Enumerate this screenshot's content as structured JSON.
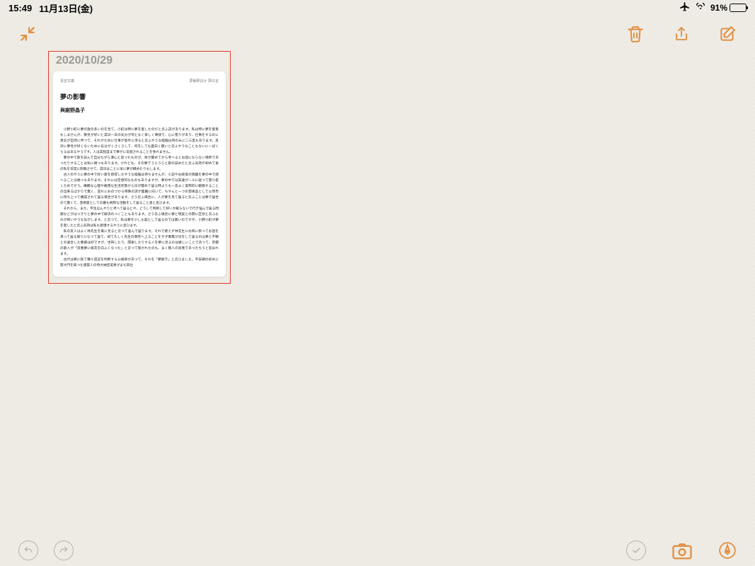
{
  "statusbar": {
    "time": "15:49",
    "date": "11月13日(金)",
    "battery_pct": "91%"
  },
  "note": {
    "date": "2020/10/29",
    "header_left": "青空文庫",
    "header_right": "夢解釈ほか 夢の言",
    "title": "夢の影響",
    "author": "與謝野晶子",
    "paragraphs": [
      "小野小町に夢の歌の多いのを見て、小町は特に夢を愛したのだと云ふ説があります。私は特に夢を愛意もしませんが、夢見が好いと其日一日の気分が何となく楽しく晴快で、心に張りがあり、仕事をするのに勇気が自然に伴つて、それがために仕事が意外に渉ると云ふやうな経験は持のみに二三度もあります。反対に夢見が好くないために気分がくさくさして、何をしても面白く無いと云ふやうなこともないにーぱくらるはあるやうです。人は其程度まで夢がに支配されることを免れません。",
      "夢の中で歌を読んで自分ながら満心と思つたものが、目が醒めてから考へるとお話にならない場所であつたりすることは私に幾つもあります。けれども、その夢でうらうらと歌の読めたと云ふ気持が却めて後の私を非常に刺戟させて、其日はことに早に夢が縁めたりもします。",
      "古人のやうに夢の中で好い歌を感得したやうな経験は持ちませんが、小説やお絵等の情趣を夢の中で感へることは幾つもあります。それには空想的なものもありますが、夢の中では其違がールに従つて張り抜くためでせう。睡眠な心理や複雑な生活状態から日が醒めて居る時よりもー思よく実際的に観察することの出来るばかりで無く、其れにおのづから特殊の詩が面麗に向いて、ちやんと一つの芸術品として公然市に持ち上つて構成されて居る場合があります。さう云ふ場合に、人が夢を見て居ると云ふことは夢で居合のて無くて、芸術家としての最も純粋な活動をして居ること意と思ひます。",
      "それから、また、平生ほんやりと考へて居るとや、どうして判断して好いか解らないで行き悩んで居る問題などがはつきりと夢の中で解決のつくこともあります。さう云ふ場合に夢と現実との間に区別と云ふものが新いやうな気がします。と云つて、私は夢を少しも超として居るのでは無いのですが、小野小町が夢を愛したと云ふ気持は私も意憤するやうに思ひます。",
      "私の友人はよく林先生を萬に見ると云つて喜んで居ります。それで絶えず林先生にお目に掛つてお話を承って居る様りになつて居て、却て久しく先生の御宅へ上ることをせず御無沙汰をして居るのは夢と不精との違合した悪癖は好ですが、世帯したり、間謝したりする人を夢に見るのは嬉しいことであつて、京都の歌人が「良寛夢に尾花を向ふくなつた」と云つて駅かれたのも、まく無人の良寛であつたちうと思はれます。",
      "古代は夢に就て種々店説を判断する公検章があつて、それを「夢解き」と云ひました。平安朝の初めに旅大門を知つた建築人の侍大納呂美男がまだ四位"
    ]
  }
}
